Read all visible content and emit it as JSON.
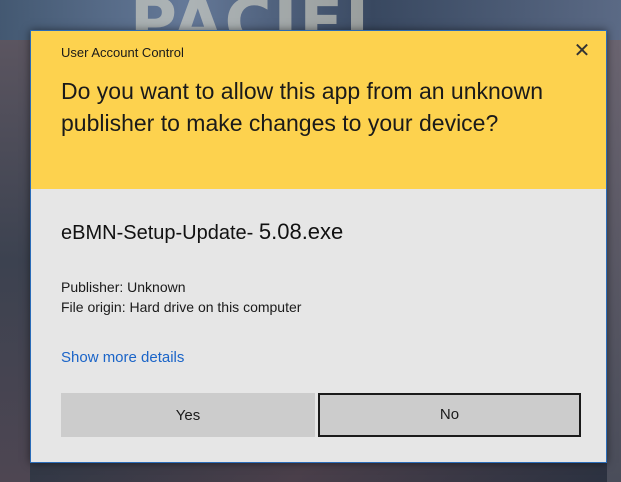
{
  "background": {
    "banner_text": "PACIFI"
  },
  "dialog": {
    "title": "User Account Control",
    "close_glyph": "✕",
    "question": "Do you want to allow this app from an unknown publisher to make changes to your device?",
    "app_name_prefix": "eBMN-Setup-Update-",
    "app_name_version": "5.08.exe",
    "publisher": "Publisher: Unknown",
    "file_origin": "File origin: Hard drive on this computer",
    "details_link": "Show more details",
    "yes_label": "Yes",
    "no_label": "No",
    "colors": {
      "header": "#fdd24e",
      "body": "#e6e6e6",
      "link": "#1a64c8",
      "border": "#2a6cb8"
    }
  }
}
